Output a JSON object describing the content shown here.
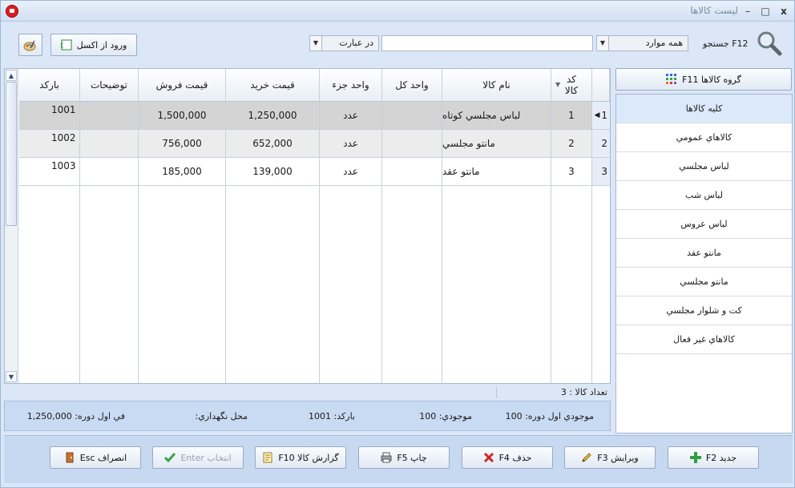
{
  "window": {
    "title": "لیست کالاها",
    "controls": {
      "close": "x",
      "maximize": "□",
      "minimize": "–"
    }
  },
  "toolbar": {
    "search_label": "جستجو F12",
    "scope_value": "همه موارد",
    "match_value": "در عبارت",
    "search_value": "",
    "import_excel_label": "ورود از اکسل"
  },
  "grid": {
    "columns": [
      "بارکد",
      "توضیحات",
      "قیمت فروش",
      "قیمت خرید",
      "واحد جزء",
      "واحد کل",
      "نام کالا",
      "کد کالا"
    ],
    "rows": [
      {
        "row_no": "1",
        "code": "1",
        "name": "لباس مجلسي کوتاه",
        "unit_total": "",
        "unit_part": "عدد",
        "buy_price": "1,250,000",
        "sell_price": "1,500,000",
        "desc": "",
        "barcode": "1001"
      },
      {
        "row_no": "2",
        "code": "2",
        "name": "مانتو مجلسي",
        "unit_total": "",
        "unit_part": "عدد",
        "buy_price": "652,000",
        "sell_price": "756,000",
        "desc": "",
        "barcode": "1002"
      },
      {
        "row_no": "3",
        "code": "3",
        "name": "مانتو عقد",
        "unit_total": "",
        "unit_part": "عدد",
        "buy_price": "139,000",
        "sell_price": "185,000",
        "desc": "",
        "barcode": "1003"
      }
    ],
    "count_label": "تعداد کالا : 3"
  },
  "info_bar": {
    "opening_stock": "موجودي اول دوره: 100",
    "stock": "موجودي: 100",
    "barcode": "بارکد: 1001",
    "location": "محل نگهداري:",
    "opening_price": "في اول دوره: 1,250,000"
  },
  "groups": {
    "button_label": "گروه کالاها F11",
    "items": [
      "کليه کالاها",
      "کالاهاي عمومي",
      "لباس مجلسي",
      "لباس شب",
      "لباس عروس",
      "مانتو عقد",
      "مانتو مجلسي",
      "کت و شلوار مجلسي",
      "کالاهاي غير فعال"
    ]
  },
  "actions": {
    "new": "جديد F2",
    "edit": "ويرايش F3",
    "delete": "حذف F4",
    "print": "چاپ F5",
    "report": "گزارش کالا F10",
    "select": "انتخاب Enter",
    "cancel": "انصراف Esc"
  },
  "colors": {
    "accent_red": "#d42020",
    "selection_blue": "#dbe9fb",
    "row_selected": "#d4d4d4",
    "row_alt": "#ececec"
  }
}
